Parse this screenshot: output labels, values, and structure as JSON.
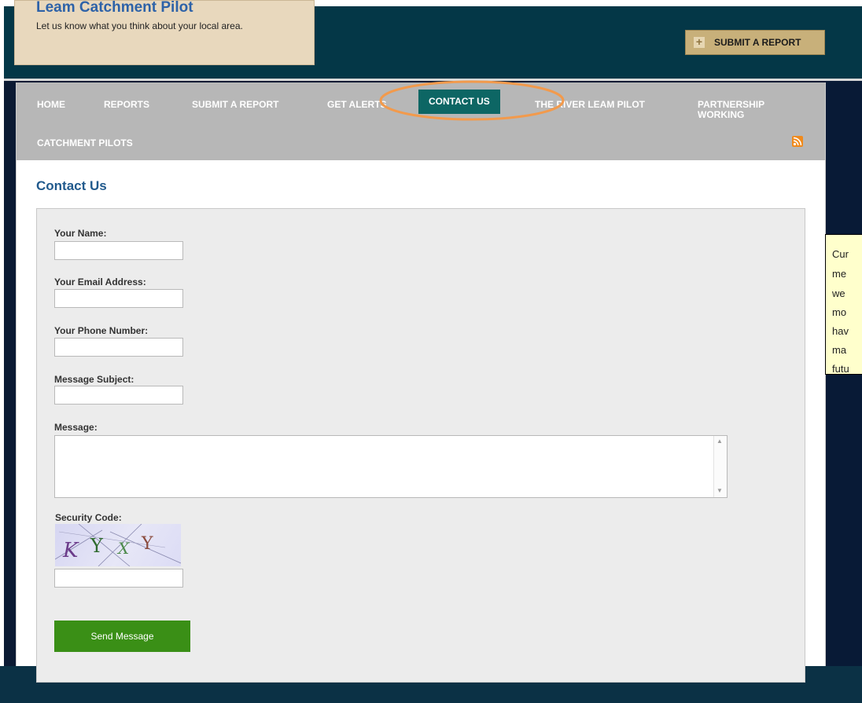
{
  "header": {
    "site_title": "Leam Catchment Pilot",
    "tagline": "Let us know what you think about your local area.",
    "submit_button_label": "SUBMIT A REPORT",
    "submit_button_icon": "plus-icon"
  },
  "nav": {
    "items": [
      {
        "label": "HOME"
      },
      {
        "label": "REPORTS"
      },
      {
        "label": "SUBMIT A REPORT"
      },
      {
        "label": "GET ALERTS"
      },
      {
        "label": "CONTACT US",
        "active": true
      },
      {
        "label": "THE RIVER LEAM PILOT"
      },
      {
        "label": "PARTNERSHIP WORKING"
      },
      {
        "label": "CATCHMENT PILOTS"
      }
    ],
    "rss_icon": "rss-icon",
    "highlight_color": "#f29a4c",
    "active_color": "#0d6664"
  },
  "page": {
    "heading": "Contact Us"
  },
  "form": {
    "name_label": "Your Name:",
    "email_label": "Your Email Address:",
    "phone_label": "Your Phone Number:",
    "subject_label": "Message Subject:",
    "message_label": "Message:",
    "security_label": "Security Code:",
    "captcha_text": "KYXY",
    "send_label": "Send Message"
  },
  "side_note": {
    "lines": [
      "Cur",
      "me",
      "we",
      "mo",
      "hav",
      "ma",
      "futu"
    ]
  },
  "colors": {
    "header_band": "#043747",
    "nav_bg": "#b7b7b7",
    "send_button": "#3a8f16",
    "heading": "#215a8d"
  }
}
